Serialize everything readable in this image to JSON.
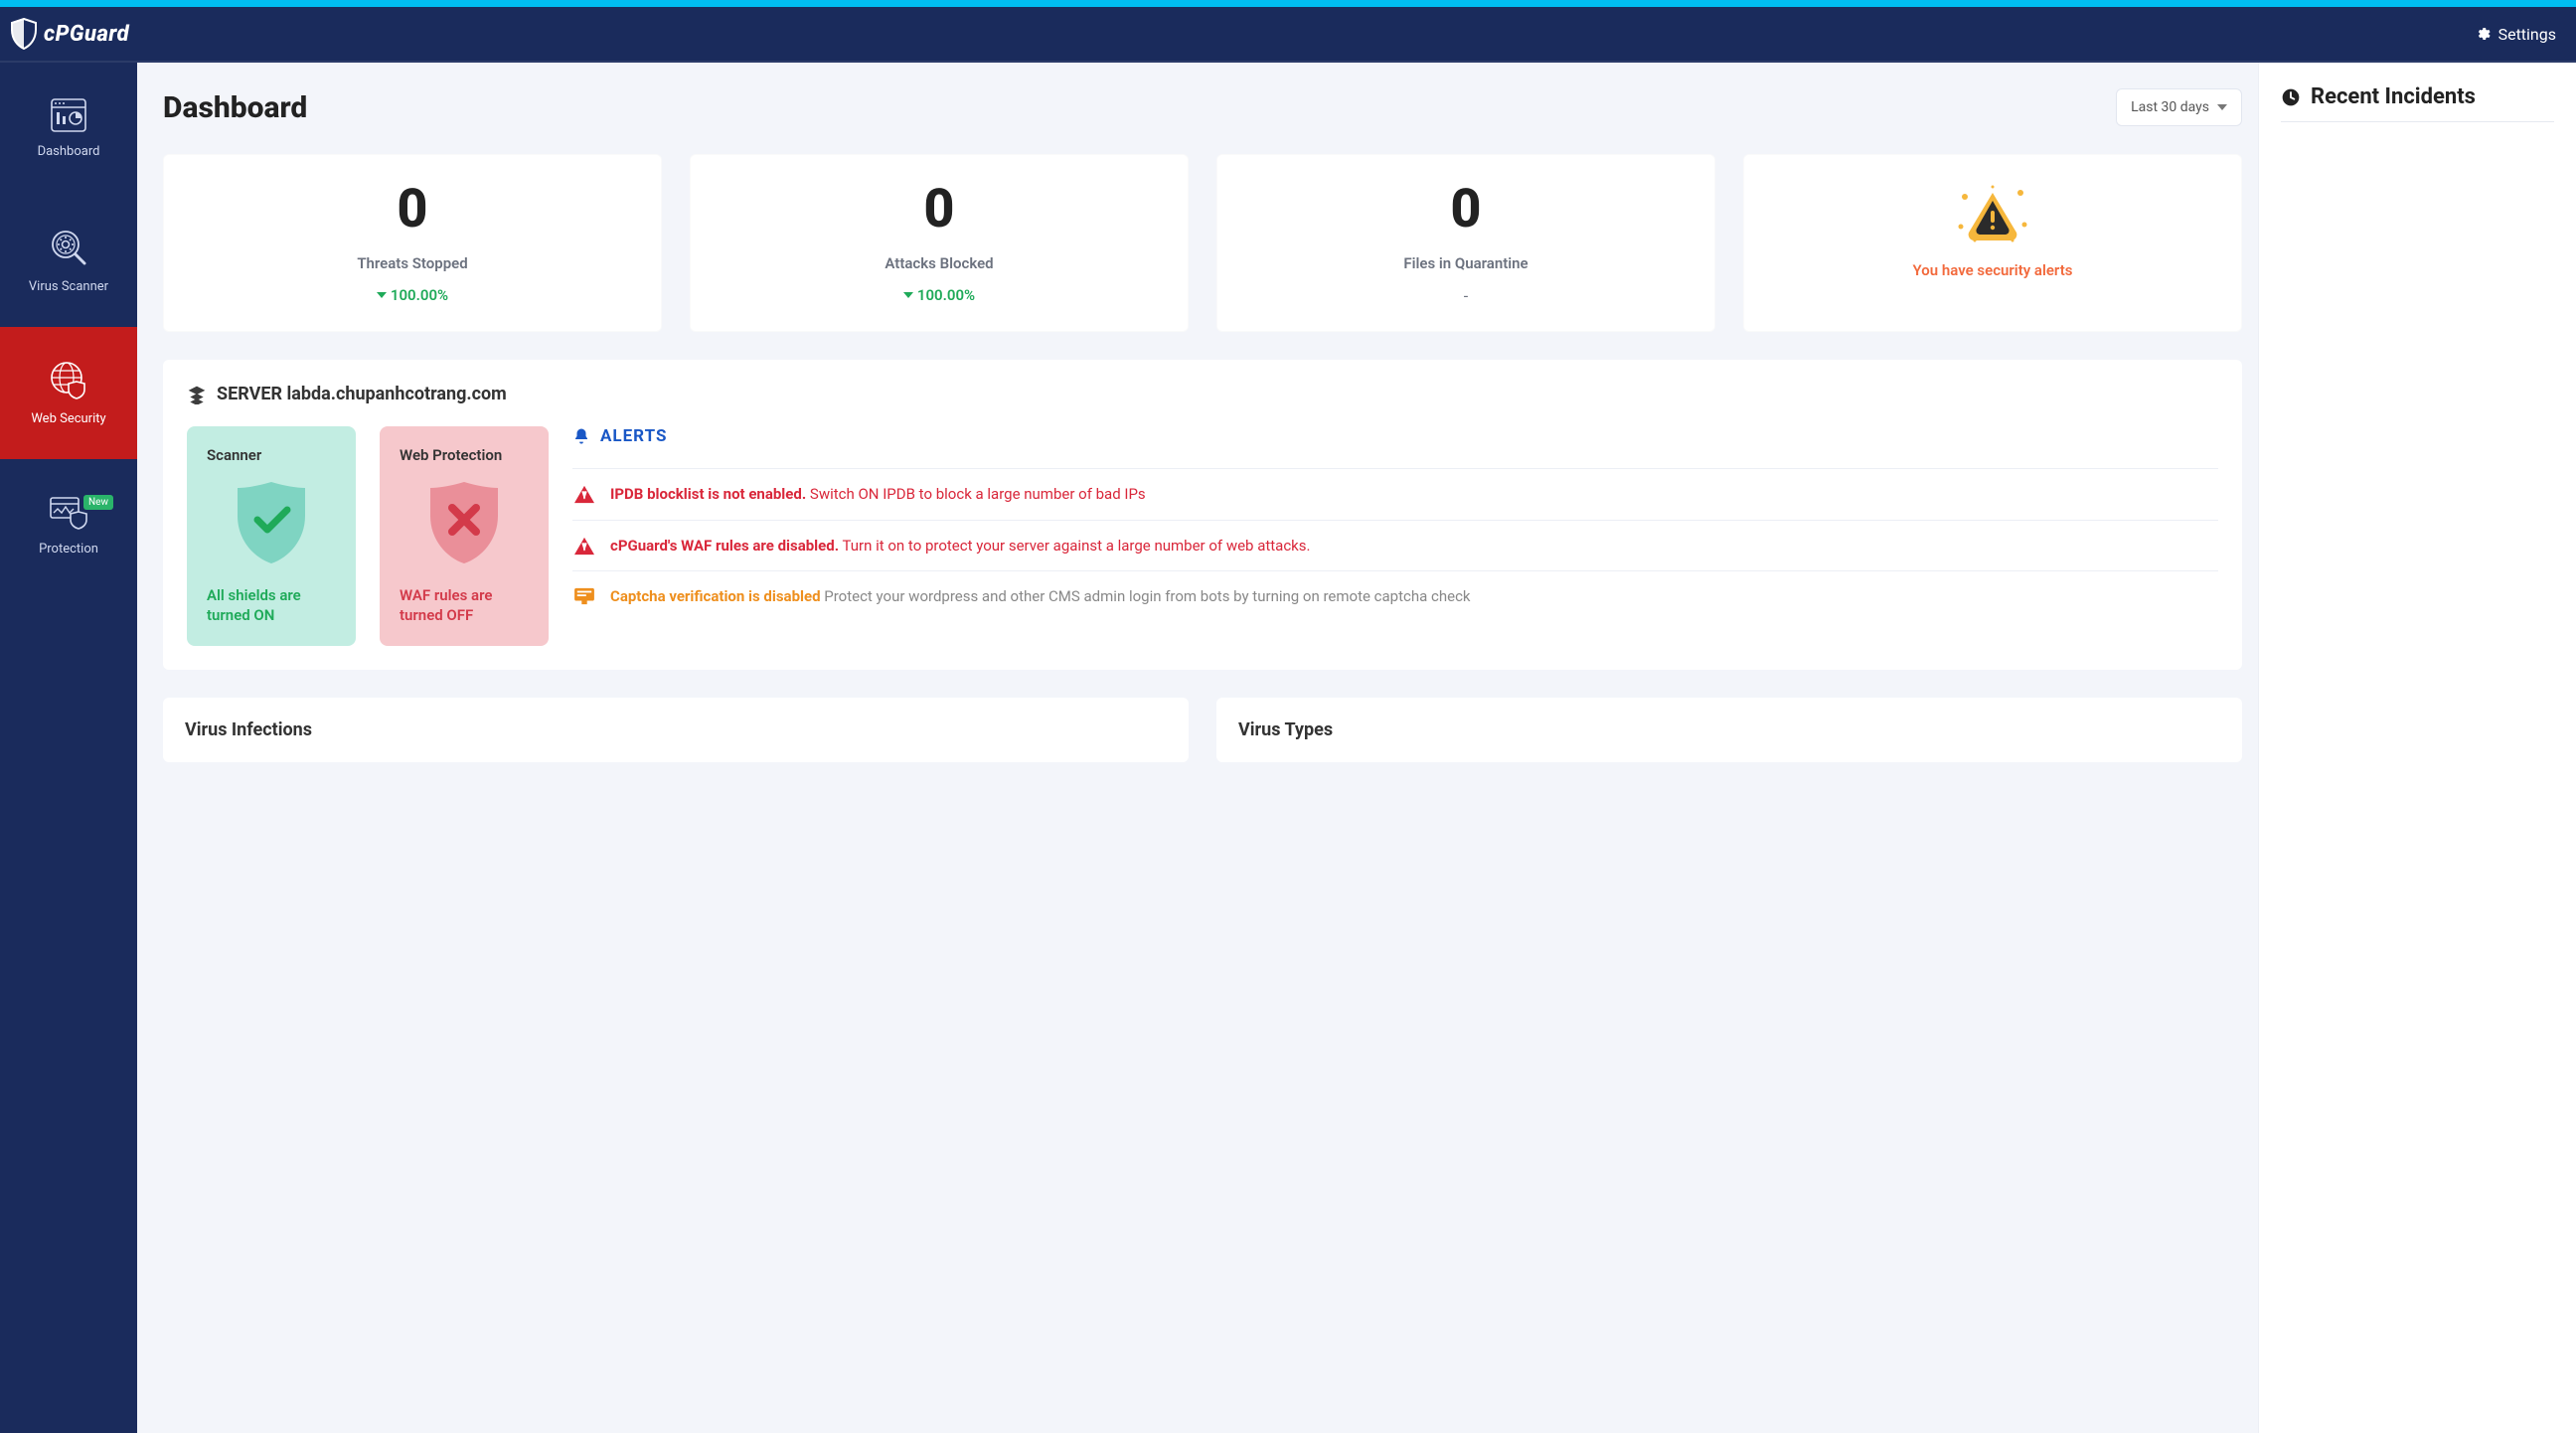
{
  "brand": "cPGuard",
  "header": {
    "settings": "Settings"
  },
  "sidebar": {
    "items": [
      {
        "label": "Dashboard"
      },
      {
        "label": "Virus Scanner"
      },
      {
        "label": "Web Security"
      },
      {
        "label": "Protection",
        "badge": "New"
      }
    ]
  },
  "page": {
    "title": "Dashboard",
    "range": "Last 30 days"
  },
  "stats": {
    "threats": {
      "value": "0",
      "label": "Threats Stopped",
      "delta": "100.00%"
    },
    "attacks": {
      "value": "0",
      "label": "Attacks Blocked",
      "delta": "100.00%"
    },
    "quarantine": {
      "value": "0",
      "label": "Files in Quarantine",
      "dash": "-"
    },
    "alerts": {
      "text": "You have security alerts"
    }
  },
  "server": {
    "heading_prefix": "SERVER",
    "hostname": "labda.chupanhcotrang.com",
    "scanner": {
      "title": "Scanner",
      "msg": "All shields are turned ON"
    },
    "web_protection": {
      "title": "Web Protection",
      "msg": "WAF rules are turned OFF"
    },
    "alerts_title": "ALERTS",
    "alerts": [
      {
        "severity": "red",
        "bold": "IPDB blocklist is not enabled.",
        "rest": "Switch ON IPDB to block a large number of bad IPs"
      },
      {
        "severity": "red",
        "bold": "cPGuard's WAF rules are disabled.",
        "rest": "Turn it on to protect your server against a large number of web attacks."
      },
      {
        "severity": "orange",
        "bold": "Captcha verification is disabled",
        "rest": "Protect your wordpress and other CMS admin login from bots by turning on remote captcha check"
      }
    ]
  },
  "charts": {
    "infections": "Virus Infections",
    "types": "Virus Types"
  },
  "right_panel": {
    "title": "Recent Incidents"
  }
}
